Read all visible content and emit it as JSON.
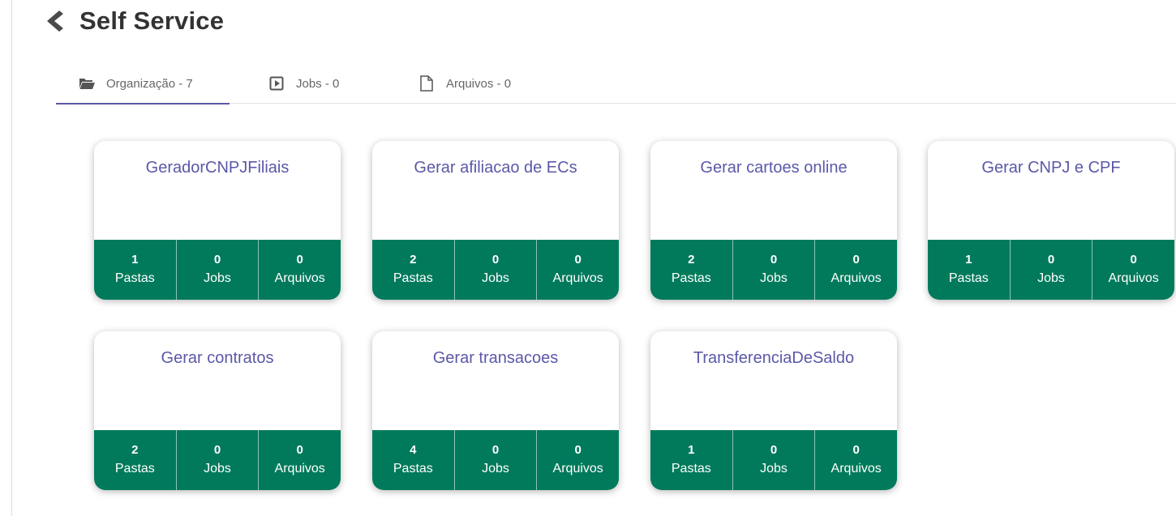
{
  "header": {
    "title": "Self Service",
    "back_icon": "chevron-left-icon"
  },
  "tabs": [
    {
      "label": "Organização - 7",
      "icon": "folder-open-icon",
      "active": true
    },
    {
      "label": "Jobs - 0",
      "icon": "play-box-icon",
      "active": false
    },
    {
      "label": "Arquivos - 0",
      "icon": "file-icon",
      "active": false
    }
  ],
  "colors": {
    "accent": "#5b58a8",
    "stats_bg": "#017a5c",
    "title": "#333333"
  },
  "cards": [
    {
      "title": "GeradorCNPJFiliais",
      "pastas": "1",
      "jobs": "0",
      "arquivos": "0",
      "pastas_label": "Pastas",
      "jobs_label": "Jobs",
      "arquivos_label": "Arquivos"
    },
    {
      "title": "Gerar afiliacao de ECs",
      "pastas": "2",
      "jobs": "0",
      "arquivos": "0",
      "pastas_label": "Pastas",
      "jobs_label": "Jobs",
      "arquivos_label": "Arquivos"
    },
    {
      "title": "Gerar cartoes online",
      "pastas": "2",
      "jobs": "0",
      "arquivos": "0",
      "pastas_label": "Pastas",
      "jobs_label": "Jobs",
      "arquivos_label": "Arquivos"
    },
    {
      "title": "Gerar CNPJ e CPF",
      "pastas": "1",
      "jobs": "0",
      "arquivos": "0",
      "pastas_label": "Pastas",
      "jobs_label": "Jobs",
      "arquivos_label": "Arquivos"
    },
    {
      "title": "Gerar contratos",
      "pastas": "2",
      "jobs": "0",
      "arquivos": "0",
      "pastas_label": "Pastas",
      "jobs_label": "Jobs",
      "arquivos_label": "Arquivos"
    },
    {
      "title": "Gerar transacoes",
      "pastas": "4",
      "jobs": "0",
      "arquivos": "0",
      "pastas_label": "Pastas",
      "jobs_label": "Jobs",
      "arquivos_label": "Arquivos"
    },
    {
      "title": "TransferenciaDeSaldo",
      "pastas": "1",
      "jobs": "0",
      "arquivos": "0",
      "pastas_label": "Pastas",
      "jobs_label": "Jobs",
      "arquivos_label": "Arquivos"
    }
  ]
}
